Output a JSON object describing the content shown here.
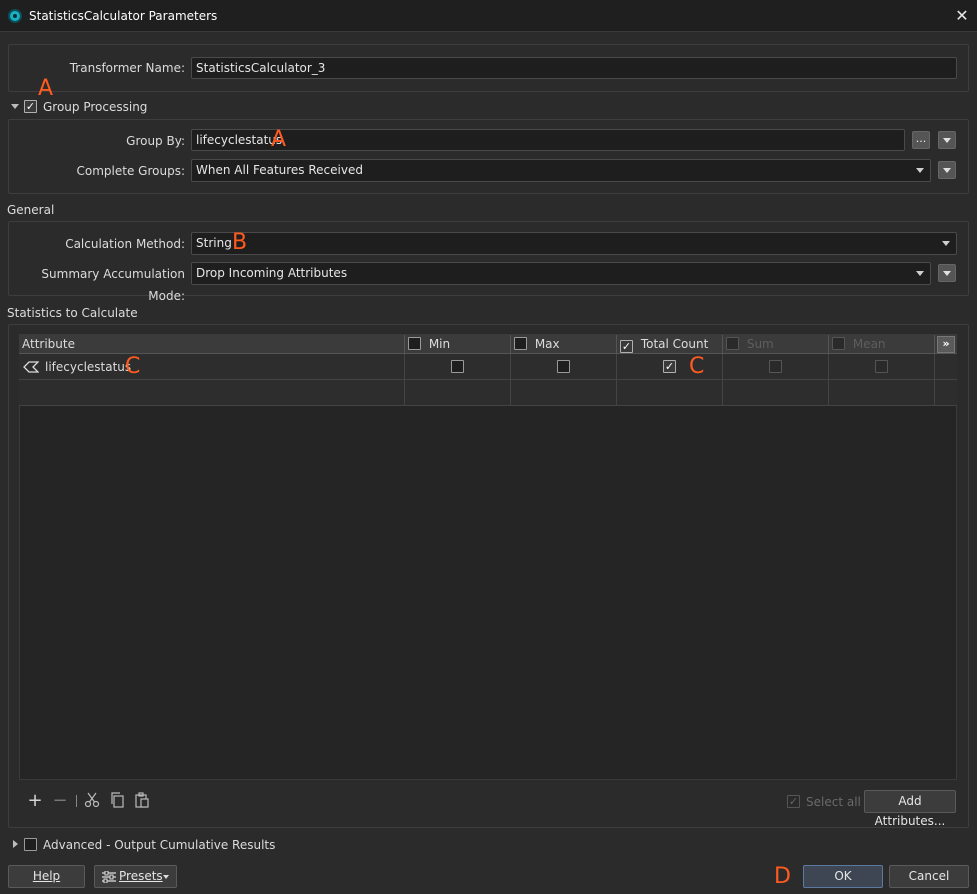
{
  "window": {
    "title": "StatisticsCalculator Parameters",
    "close_symbol": "✕"
  },
  "transformer": {
    "name_label": "Transformer Name:",
    "name_value": "StatisticsCalculator_3"
  },
  "group_processing": {
    "label": "Group Processing",
    "checked": true,
    "group_by_label": "Group By:",
    "group_by_value": "lifecyclestatus",
    "ellipsis": "...",
    "complete_groups_label": "Complete Groups:",
    "complete_groups_value": "When All Features Received"
  },
  "general": {
    "section_title": "General",
    "calc_method_label": "Calculation Method:",
    "calc_method_value": "String",
    "summary_mode_label": "Summary Accumulation Mode:",
    "summary_mode_value": "Drop Incoming Attributes"
  },
  "statistics": {
    "section_title": "Statistics to Calculate",
    "columns": [
      {
        "label": "Attribute",
        "checkbox": false,
        "checked": false,
        "disabled": false
      },
      {
        "label": "Min",
        "checkbox": true,
        "checked": false,
        "disabled": false
      },
      {
        "label": "Max",
        "checkbox": true,
        "checked": false,
        "disabled": false
      },
      {
        "label": "Total Count",
        "checkbox": true,
        "checked": true,
        "disabled": false
      },
      {
        "label": "Sum",
        "checkbox": true,
        "checked": false,
        "disabled": true
      },
      {
        "label": "Mean",
        "checkbox": true,
        "checked": false,
        "disabled": true
      }
    ],
    "more_columns_symbol": "»",
    "rows": [
      {
        "attribute": "lifecyclestatus",
        "min": false,
        "max": false,
        "total_count": true,
        "sum": false,
        "mean": false
      }
    ],
    "select_all_label": "Select all",
    "add_attributes_label": "Add Attributes..."
  },
  "advanced": {
    "label": "Advanced - Output Cumulative Results",
    "checked": false
  },
  "buttons": {
    "help": "Help",
    "presets": "Presets",
    "ok": "OK",
    "cancel": "Cancel"
  },
  "annotations": {
    "a": "A",
    "b": "B",
    "c": "C",
    "d": "D"
  },
  "colors": {
    "annotation": "#ff5a1f",
    "app_icon": "#1ab0c4"
  }
}
